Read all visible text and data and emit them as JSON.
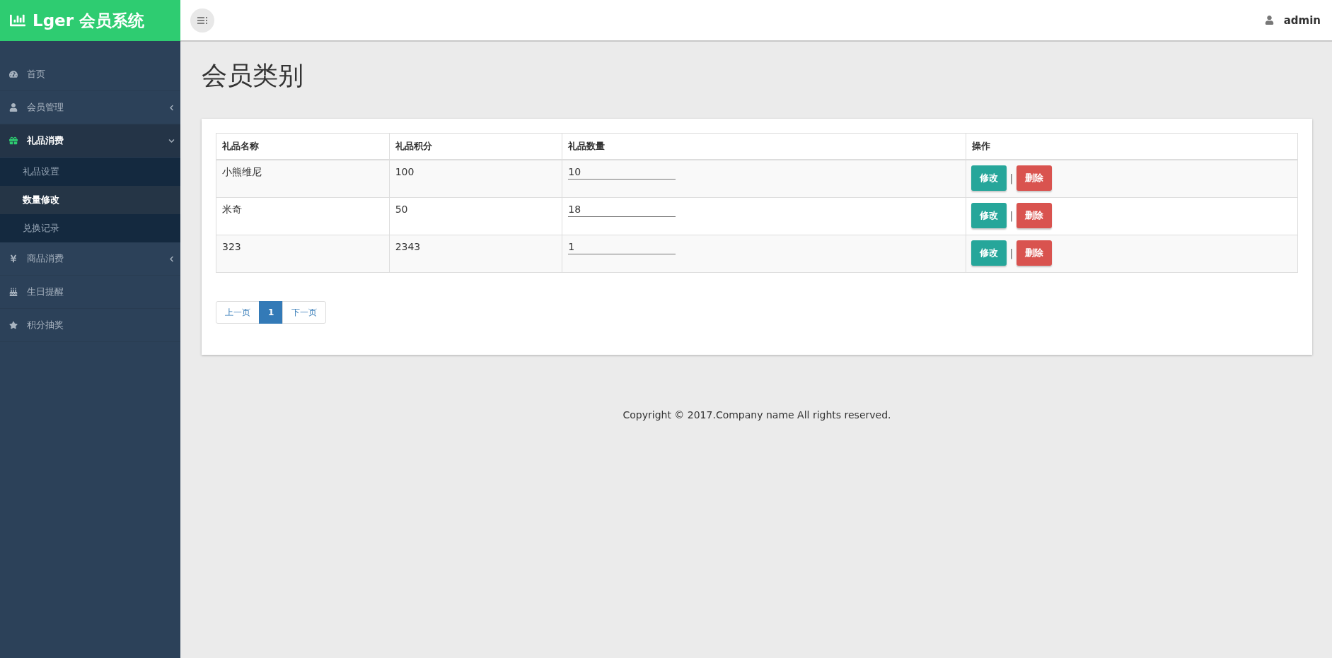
{
  "brand": {
    "title": "Lger 会员系统"
  },
  "header": {
    "user": "admin"
  },
  "sidebar": {
    "items": [
      {
        "kind": "link",
        "label": "首页",
        "selected": false
      },
      {
        "kind": "group",
        "label": "会员管理",
        "selected": false,
        "expanded": false
      },
      {
        "kind": "group",
        "label": "礼品消费",
        "selected": true,
        "expanded": true,
        "children": [
          {
            "label": "礼品设置",
            "selected": false
          },
          {
            "label": "数量修改",
            "selected": true
          },
          {
            "label": "兑换记录",
            "selected": false
          }
        ]
      },
      {
        "kind": "group",
        "label": "商品消费",
        "selected": false,
        "expanded": false
      },
      {
        "kind": "link",
        "label": "生日提醒",
        "selected": false
      },
      {
        "kind": "link",
        "label": "积分抽奖",
        "selected": false
      }
    ]
  },
  "page": {
    "title": "会员类别"
  },
  "table": {
    "columns": [
      "礼品名称",
      "礼品积分",
      "礼品数量",
      "操作"
    ],
    "rows": [
      {
        "name": "小熊维尼",
        "points": "100",
        "quantity": "10",
        "edit": "修改",
        "separator": "|",
        "delete": "删除"
      },
      {
        "name": "米奇",
        "points": "50",
        "quantity": "18",
        "edit": "修改",
        "separator": "|",
        "delete": "删除"
      },
      {
        "name": "323",
        "points": "2343",
        "quantity": "1",
        "edit": "修改",
        "separator": "|",
        "delete": "删除"
      }
    ]
  },
  "pagination": {
    "prev": "上一页",
    "pages": [
      {
        "label": "1",
        "selected": true
      }
    ],
    "next": "下一页"
  },
  "footer": {
    "text": "Copyright © 2017.Company name All rights reserved."
  }
}
